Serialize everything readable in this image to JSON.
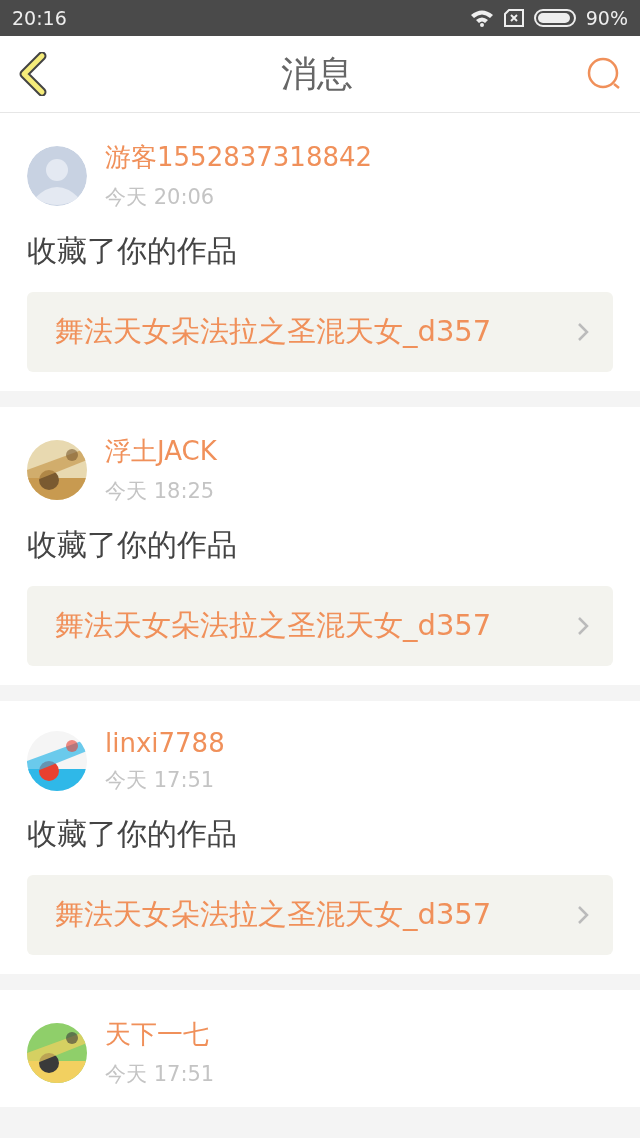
{
  "status_bar": {
    "time": "20:16",
    "battery": "90%"
  },
  "header": {
    "title": "消息"
  },
  "messages": [
    {
      "avatar": {
        "kind": "default"
      },
      "user": "游客1552837318842",
      "time": "今天 20:06",
      "action": "收藏了你的作品",
      "work": "舞法天女朵法拉之圣混天女_d357"
    },
    {
      "user": "浮土JACK",
      "time": "今天 18:25",
      "action": "收藏了你的作品",
      "work": "舞法天女朵法拉之圣混天女_d357"
    },
    {
      "user": "linxi7788",
      "time": "今天 17:51",
      "action": "收藏了你的作品",
      "work": "舞法天女朵法拉之圣混天女_d357"
    },
    {
      "user": "天下一七",
      "time": "今天 17:51"
    }
  ]
}
